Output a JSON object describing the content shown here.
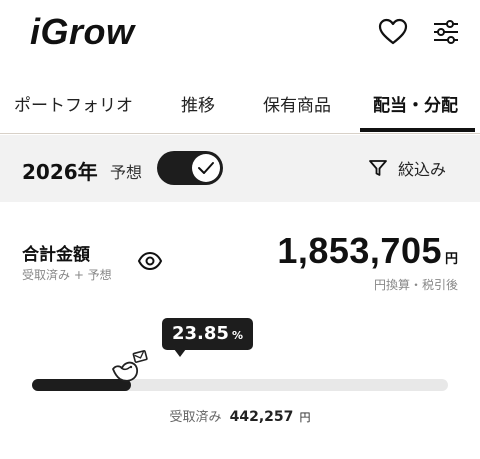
{
  "header": {
    "logo": "iGrow"
  },
  "tabs": [
    {
      "label": "ポートフォリオ",
      "active": false
    },
    {
      "label": "推移",
      "active": false
    },
    {
      "label": "保有商品",
      "active": false
    },
    {
      "label": "配当・分配",
      "active": true
    }
  ],
  "filter": {
    "year": "2026年",
    "forecast_label": "予想",
    "forecast_on": true,
    "narrow_label": "絞込み"
  },
  "total": {
    "title": "合計金額",
    "subtitle": "受取済み + 予想",
    "amount": "1,853,705",
    "unit": "円",
    "note": "円換算・税引後"
  },
  "progress": {
    "percent_label": "23.85",
    "percent_sign": "%",
    "fraction": 0.2385,
    "received_label": "受取済み",
    "received_amount": "442,257",
    "received_unit": "円"
  }
}
